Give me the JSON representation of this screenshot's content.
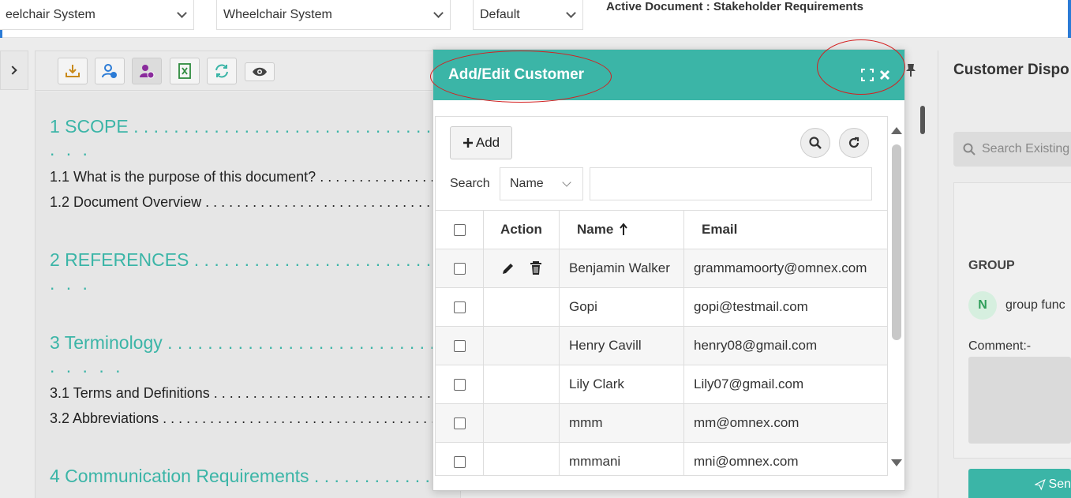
{
  "topbar": {
    "select1": "eelchair System",
    "select2": "Wheelchair System",
    "select3": "Default",
    "active_document": "Active Document : Stakeholder Requirements"
  },
  "toolbar": {
    "buttons": [
      "download-icon",
      "user-check-icon",
      "user-approve-icon",
      "excel-icon",
      "refresh-icon",
      "eye-icon"
    ]
  },
  "toc": {
    "h1": "1 SCOPE . . . . . . . . . . . . . . . . . . . . . . . . . . . . . . . . . . . . . . . . . .",
    "h1_cont": ". . .",
    "s11": "1.1 What is the purpose of this document? . . . . . . . . . . . . . . . . . . . . . .",
    "s12": "1.2 Document Overview . . . . . . . . . . . . . . . . . . . . . . . . . . . . . . . . . . . . . . .",
    "h2": "2 REFERENCES . . . . . . . . . . . . . . . . . . . . . . . . . . . . . . . . . . . . . .",
    "h2_cont": ". . .",
    "h3": "3 Terminology . . . . . . . . . . . . . . . . . . . . . . . . . . . . . . . . . . . . . . .",
    "h3_cont": ". . . . .",
    "s31": "3.1 Terms and Definitions . . . . . . . . . . . . . . . . . . . . . . . . . . . . . . . . . . . . .",
    "s32": "3.2 Abbreviations . . . . . . . . . . . . . . . . . . . . . . . . . . . . . . . . . . . . . . . . . . . . .",
    "h4": "4 Communication Requirements . . . . . . . . . . . . . . . . . ."
  },
  "right_panel": {
    "title": "Customer Dispo",
    "search_placeholder": "Search Existing",
    "group_label": "GROUP",
    "avatar_initial": "N",
    "group_text": "group func",
    "comment_label": "Comment:-",
    "send_label": "Sen"
  },
  "modal": {
    "title": "Add/Edit Customer",
    "add_label": "Add",
    "search_label": "Search",
    "search_field": "Name",
    "search_value": "",
    "columns": {
      "action": "Action",
      "name": "Name",
      "email": "Email"
    },
    "rows": [
      {
        "name": "Benjamin Walker",
        "email": "grammamoorty@omnex.com",
        "has_actions": true
      },
      {
        "name": "Gopi",
        "email": "gopi@testmail.com",
        "has_actions": false
      },
      {
        "name": "Henry Cavill",
        "email": "henry08@gmail.com",
        "has_actions": false
      },
      {
        "name": "Lily Clark",
        "email": "Lily07@gmail.com",
        "has_actions": false
      },
      {
        "name": "mmm",
        "email": "mm@omnex.com",
        "has_actions": false
      },
      {
        "name": "mmmani",
        "email": "mni@omnex.com",
        "has_actions": false
      }
    ]
  },
  "colors": {
    "accent": "#3bb5a7",
    "annotation": "#d42020"
  }
}
